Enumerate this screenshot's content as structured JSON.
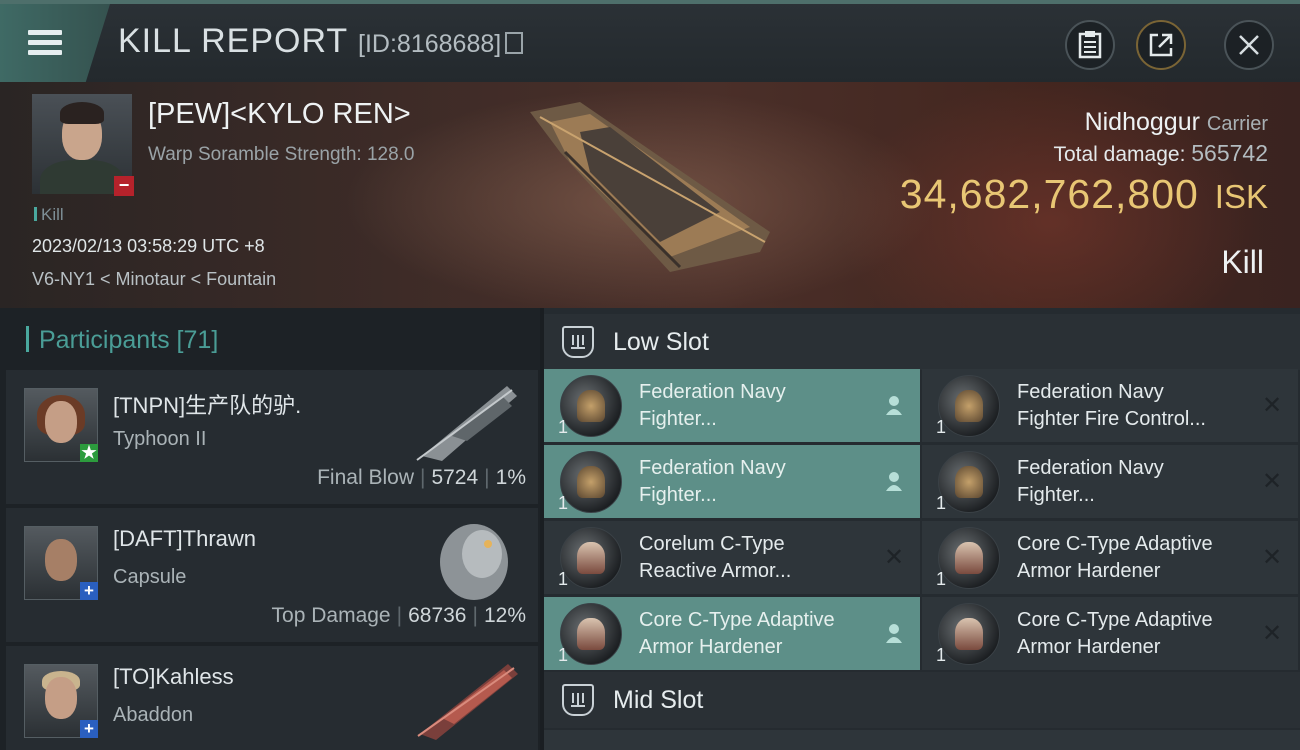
{
  "topbar": {
    "title": "KILL REPORT",
    "report_id": "[ID:8168688]",
    "buttons": [
      "clipboard",
      "share",
      "close"
    ]
  },
  "victim": {
    "name": "[PEW]<KYLO REN>",
    "warp_scramble": "Warp Soramble Strength: 128.0",
    "tag": "Kill",
    "datetime": "2023/02/13 03:58:29 UTC +8",
    "location": "V6-NY1 < Minotaur < Fountain",
    "ship": "Nidhoggur",
    "ship_class": "Carrier",
    "total_damage_label": "Total damage:",
    "total_damage": "565742",
    "isk_value": "34,682,762,800",
    "isk_unit": "ISK",
    "result": "Kill"
  },
  "participants": {
    "header": "Participants [71]",
    "list": [
      {
        "name": "[TNPN]生产队的驴.",
        "ship": "Typhoon II",
        "role": "Final Blow",
        "damage": "5724",
        "percent": "1%",
        "badge": "★"
      },
      {
        "name": "[DAFT]Thrawn",
        "ship": "Capsule",
        "role": "Top Damage",
        "damage": "68736",
        "percent": "12%",
        "badge": "+"
      },
      {
        "name": "[TO]Kahless",
        "ship": "Abaddon",
        "role": "",
        "damage": "",
        "percent": "",
        "badge": "+"
      }
    ]
  },
  "fitting": {
    "low_slot_title": "Low Slot",
    "mid_slot_title": "Mid Slot",
    "low_slot": [
      {
        "qty": "1",
        "name": "Federation Navy\nFighter...",
        "status": "person",
        "highlight": true
      },
      {
        "qty": "1",
        "name": "Federation Navy\nFighter Fire Control...",
        "status": "x",
        "highlight": false
      },
      {
        "qty": "1",
        "name": "Federation Navy\nFighter...",
        "status": "person",
        "highlight": true
      },
      {
        "qty": "1",
        "name": "Federation Navy\nFighter...",
        "status": "x",
        "highlight": false
      },
      {
        "qty": "1",
        "name": "Corelum C-Type\nReactive Armor...",
        "status": "x",
        "highlight": false
      },
      {
        "qty": "1",
        "name": "Core C-Type Adaptive\n Armor Hardener",
        "status": "x",
        "highlight": false
      },
      {
        "qty": "1",
        "name": "Core C-Type Adaptive\n Armor Hardener",
        "status": "person",
        "highlight": true
      },
      {
        "qty": "1",
        "name": "Core C-Type Adaptive\n Armor Hardener",
        "status": "x",
        "highlight": false
      }
    ]
  }
}
